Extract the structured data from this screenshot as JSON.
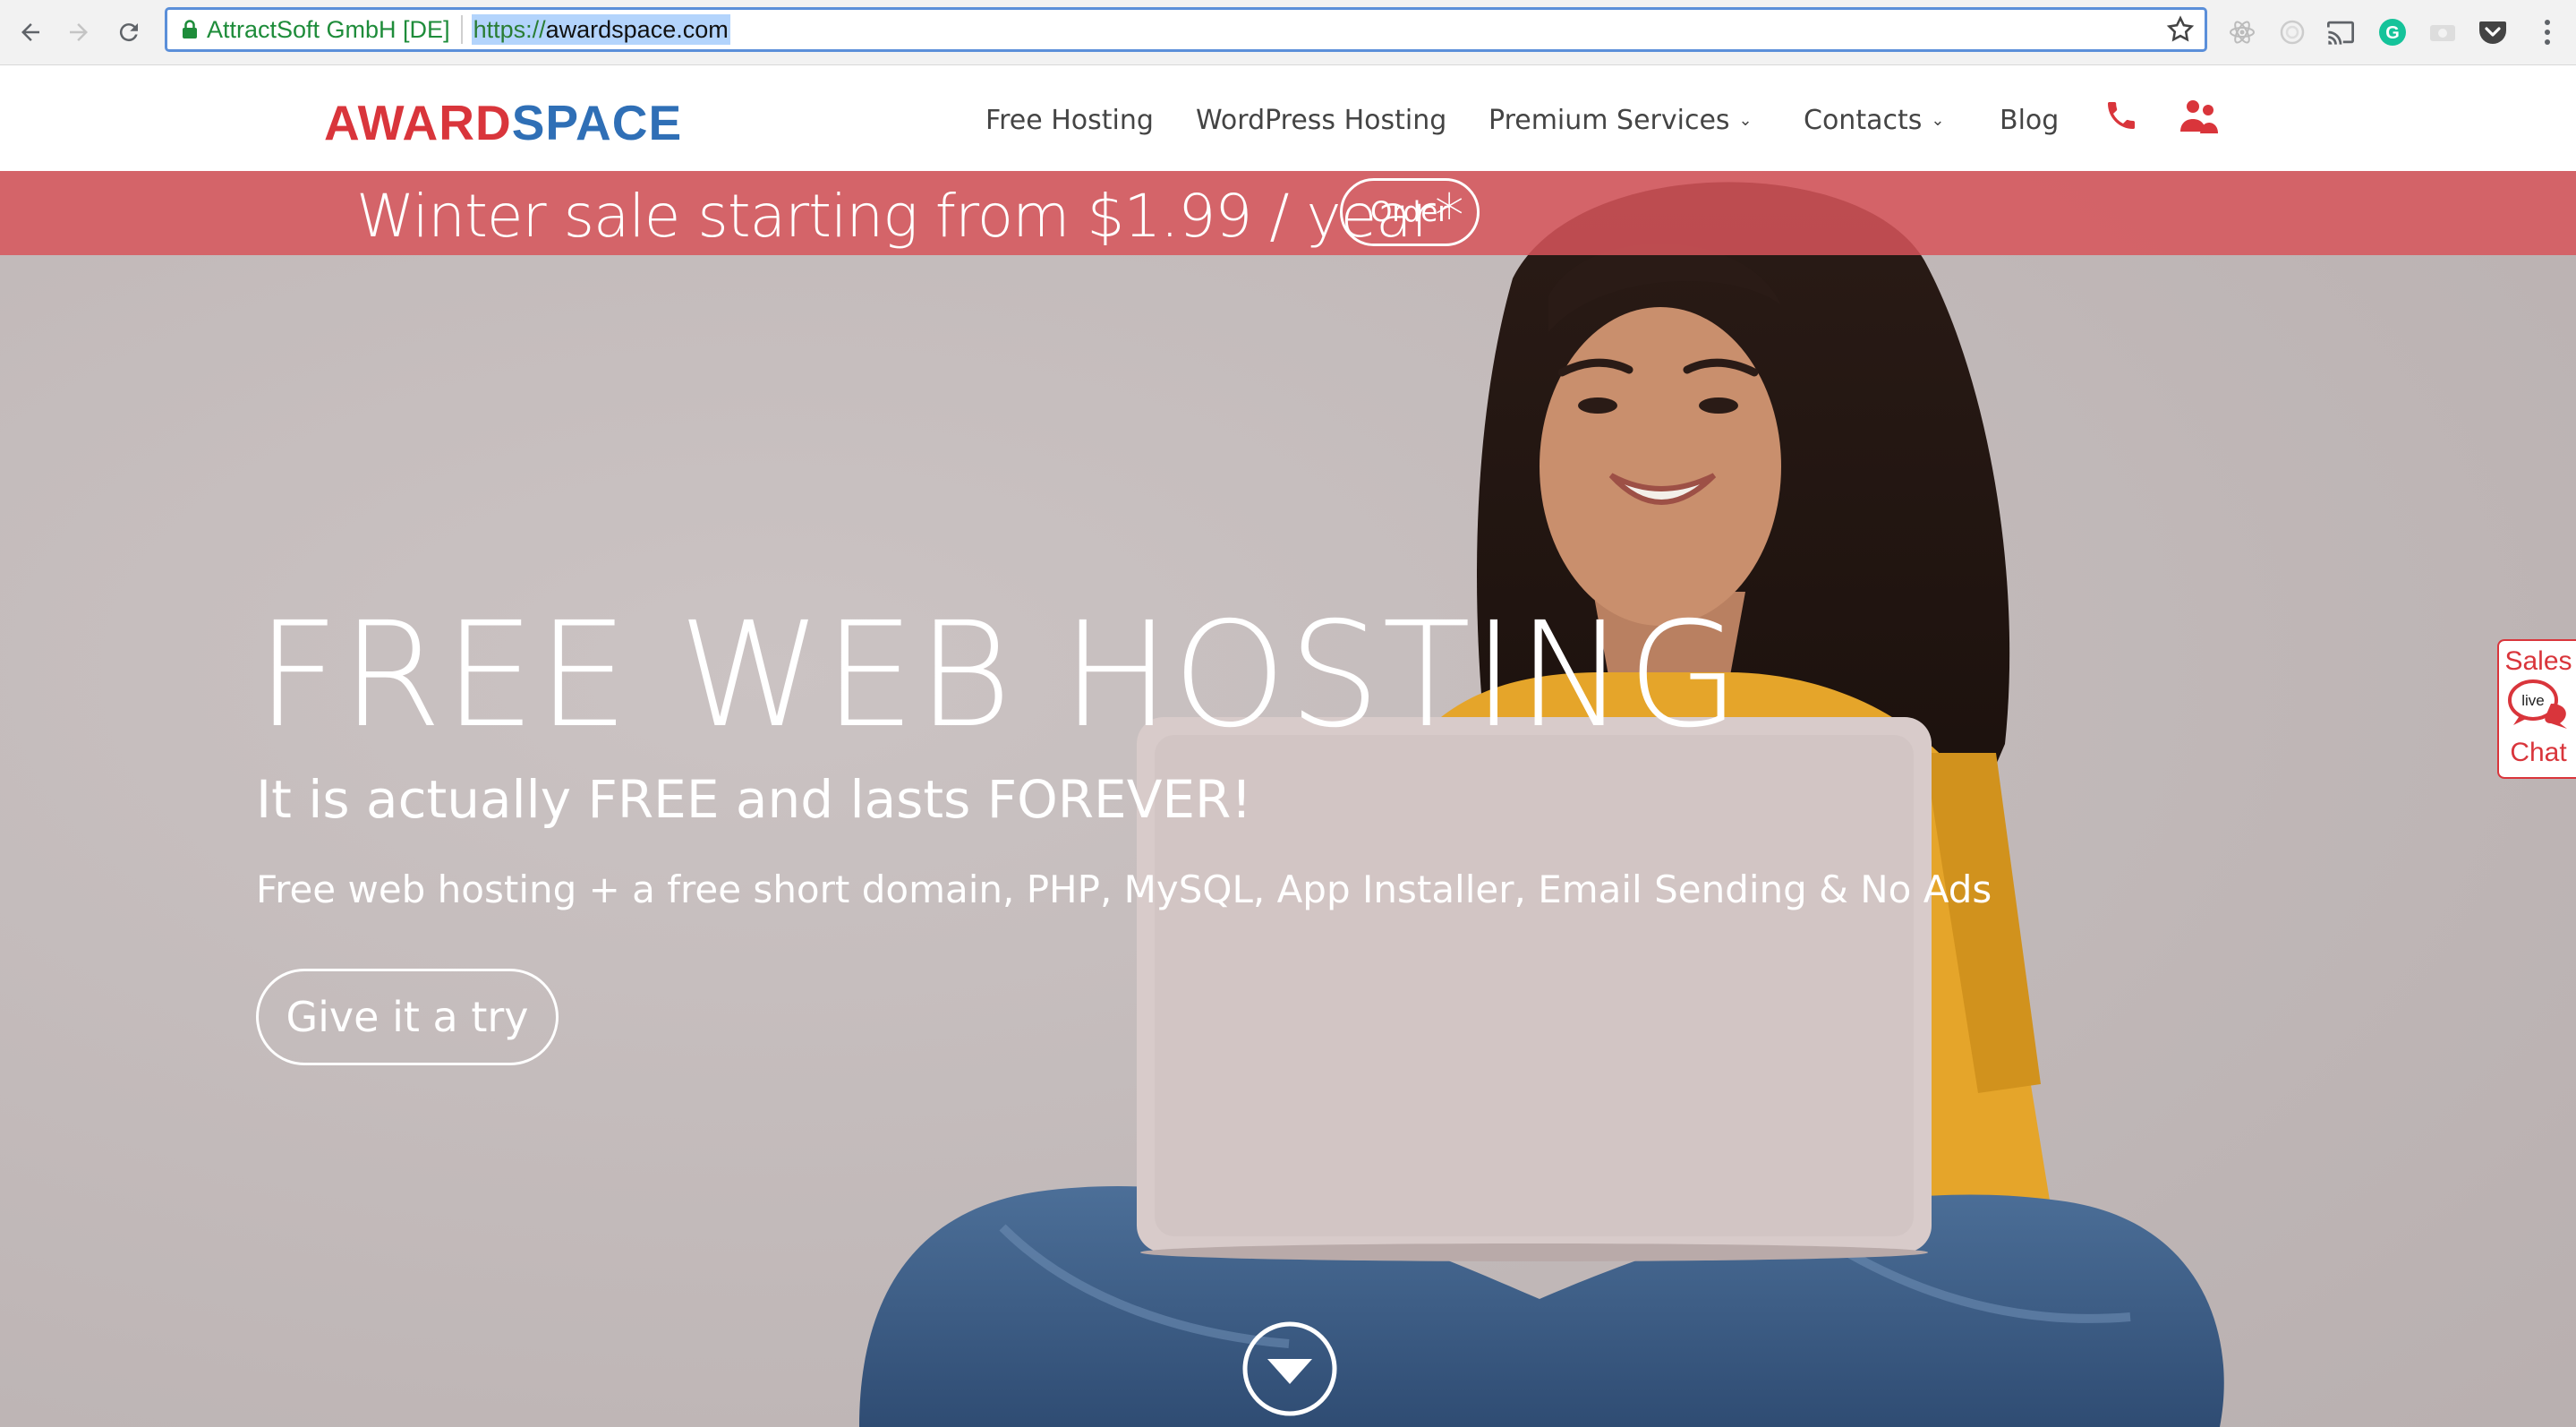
{
  "browser": {
    "site_identity": "AttractSoft GmbH [DE]",
    "url_scheme": "https://",
    "url_host": "awardspace.com"
  },
  "header": {
    "logo_award": "AWARD",
    "logo_space": "SPACE",
    "menu": [
      {
        "label": "Free Hosting"
      },
      {
        "label": "WordPress Hosting"
      },
      {
        "label": "Premium Services",
        "has_dropdown": true
      },
      {
        "label": "Contacts",
        "has_dropdown": true
      },
      {
        "label": "Blog"
      }
    ],
    "icons": [
      "phone-icon",
      "users-icon"
    ]
  },
  "promo": {
    "text": "Winter sale starting from $1.99 / year*",
    "button": "Order"
  },
  "hero": {
    "title": "FREE WEB HOSTING",
    "subtitle": "It is actually FREE and lasts FOREVER!",
    "description": "Free web hosting + a free short domain, PHP, MySQL, App Installer, Email Sending & No Ads",
    "cta": "Give it a try"
  },
  "live_chat": {
    "top": "Sales",
    "badge": "live",
    "bottom": "Chat"
  },
  "colors": {
    "brand_red": "#d9353b",
    "brand_blue": "#2f6fb6",
    "promo_bar": "#d7555a"
  }
}
